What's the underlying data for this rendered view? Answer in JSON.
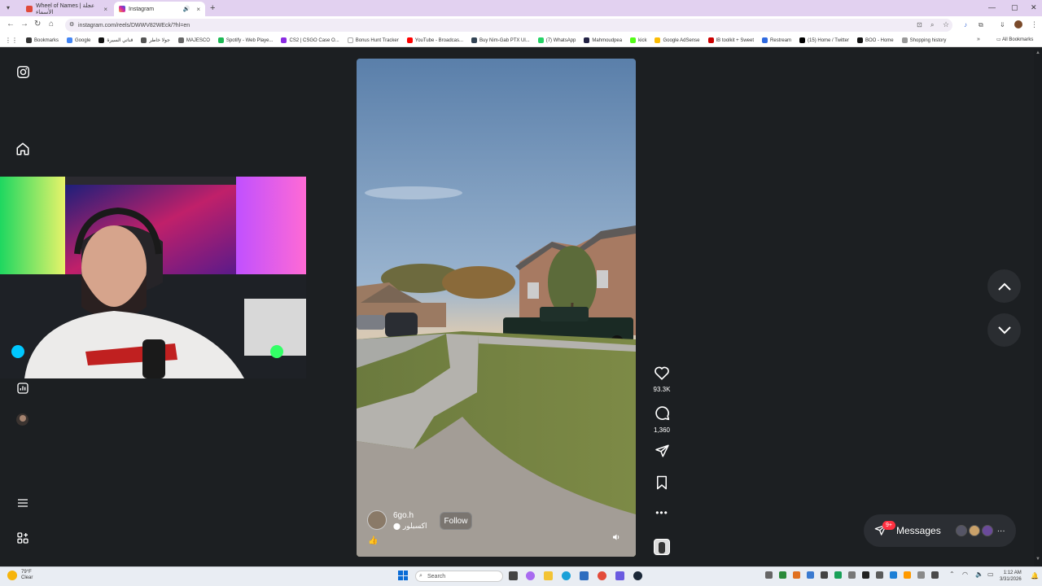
{
  "browser": {
    "tabs": [
      {
        "label": "Wheel of Names | عجلة الأسماء",
        "active": false
      },
      {
        "label": "Instagram",
        "active": true
      }
    ],
    "url": "instagram.com/reels/DWWV82WEck/?hl=en",
    "bookmarks": [
      "Bookmarks",
      "Google",
      "قناتي السيرة",
      "جولا خاطر",
      "MAJESCO",
      "Spotify - Web Playe...",
      "CS2 | CSGO Case O...",
      "Bonus Hunt Tracker",
      "YouTube - Broadcas...",
      "Buy Nim-Gab PTX Ul...",
      "(7) WhatsApp",
      "Mahmoudpea",
      "kick",
      "Google AdSense",
      "IB toolkit + Sweet",
      "Restream",
      "(15) Home / Twitter",
      "BOO - Home",
      "Shopping history"
    ],
    "all_bookmarks": "All Bookmarks"
  },
  "reel": {
    "author": "6go.h",
    "location": "اكسبلور",
    "follow_label": "Follow",
    "emoji": "👍",
    "likes": "93.3K",
    "comments": "1,360"
  },
  "messages": {
    "label": "Messages",
    "badge": "9+"
  },
  "taskbar": {
    "weather_temp": "79°F",
    "weather_desc": "Clear",
    "search_placeholder": "Search",
    "time": "1:12 AM",
    "date": "3/31/2026"
  },
  "colors": {
    "page_bg": "#1c1f22",
    "tab_strip": "#e2d1f0",
    "badge": "#ff3040"
  }
}
